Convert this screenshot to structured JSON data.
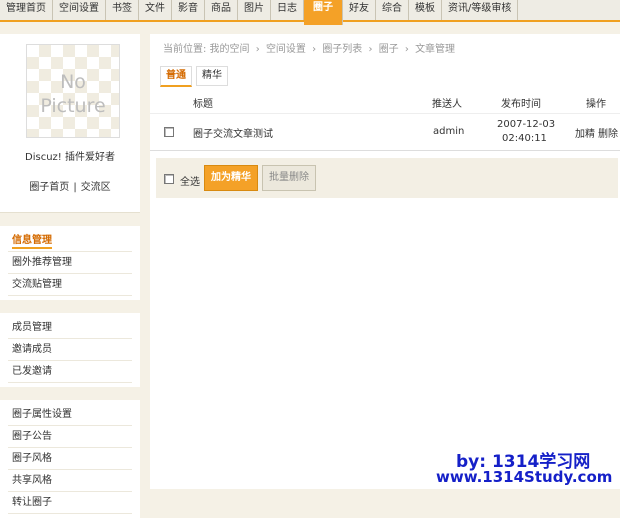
{
  "topnav": {
    "tabs": [
      "管理首页",
      "空间设置",
      "书签",
      "文件",
      "影音",
      "商品",
      "图片",
      "日志",
      "圈子",
      "好友",
      "综合",
      "模板",
      "资讯/等级审核"
    ],
    "active": "圈子",
    "accent": "#f4a127"
  },
  "profile": {
    "avatar_line1": "No",
    "avatar_line2": "Picture",
    "name": "Discuz! 插件爱好者",
    "link_home": "圈子首页",
    "link_separator": "|",
    "link_exchange": "交流区"
  },
  "sidebar": {
    "group1": [
      "信息管理",
      "圈外推荐管理",
      "交流贴管理"
    ],
    "group2": [
      "成员管理",
      "邀请成员",
      "已发邀请"
    ],
    "group3": [
      "圈子属性设置",
      "圈子公告",
      "圈子风格",
      "共享风格",
      "转让圈子"
    ]
  },
  "breadcrumb": {
    "prefix": "当前位置: 我的空间",
    "items": [
      "空间设置",
      "圈子列表",
      "圈子",
      "文章管理"
    ],
    "sep": "›"
  },
  "tabs": [
    "普通",
    "精华"
  ],
  "table": {
    "headers": {
      "title": "标题",
      "sender": "推送人",
      "time": "发布时间",
      "ops": "操作"
    },
    "rows": [
      {
        "title": "圈子交流文章测试",
        "sender": "admin",
        "date": "2007-12-03",
        "time": "02:40:11",
        "op1": "加精",
        "op2": "删除"
      }
    ]
  },
  "actions": {
    "select_all": "全选",
    "feature": "加为精华",
    "bulk_delete": "批量删除"
  },
  "watermark": {
    "line1": "by: 1314学习网",
    "line2": "www.1314Study.com",
    "color": "#1520c8"
  }
}
